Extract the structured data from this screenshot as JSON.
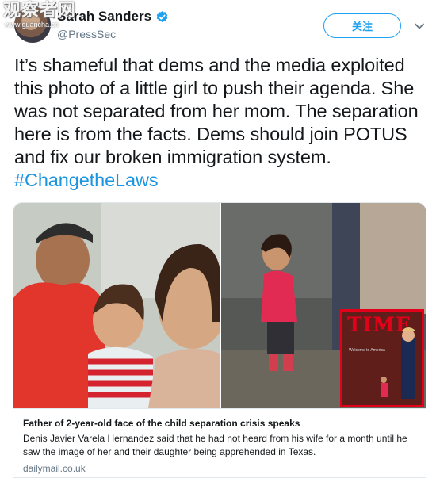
{
  "watermark": {
    "text": "观察者网",
    "url": "www.guancha.cn"
  },
  "user": {
    "name": "Sarah Sanders",
    "handle": "@PressSec"
  },
  "follow_label": "关注",
  "tweet": {
    "text": "It’s shameful that dems and the media exploited this photo of a little girl to push their agenda. She was not separated from her mom. The separation here is from the facts. Dems should join POTUS and fix our broken immigration system.",
    "hashtag": "#ChangetheLaws"
  },
  "card": {
    "title": "Father of 2-year-old face of the child separation crisis speaks",
    "description": "Denis Javier Varela Hernandez said that he had not heard from his wife for a month until he saw the image of her and their daughter being apprehended in Texas.",
    "domain": "dailymail.co.uk",
    "time_cover": {
      "logo": "TIME",
      "subtitle": "Welcome to America"
    }
  },
  "colors": {
    "accent": "#1da1f2",
    "hashtag": "#1b95e0",
    "secondary_text": "#657786",
    "time_red": "#e3001b"
  }
}
